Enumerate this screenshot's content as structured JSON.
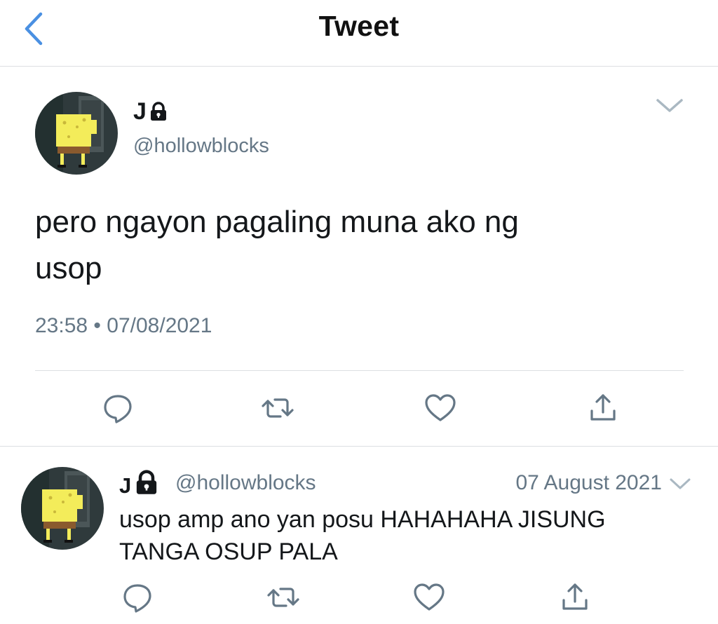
{
  "header": {
    "title": "Tweet"
  },
  "main_tweet": {
    "name": "J",
    "handle": "@hollowblocks",
    "text_line1": "pero ngayon pagaling muna ako ng",
    "text_line2": "usop",
    "time": "23:58",
    "dot": "•",
    "date": "07/08/2021"
  },
  "reply_tweet": {
    "name": "J",
    "handle": "@hollowblocks",
    "date": "07 August 2021",
    "text_line1": "usop amp ano yan posu HAHAHAHA JISUNG",
    "text_line2": "TANGA OSUP PALA"
  },
  "icons": {
    "back": "chevron-left-icon",
    "lock": "lock-icon",
    "more": "chevron-down-icon",
    "reply": "reply-icon",
    "retweet": "retweet-icon",
    "like": "heart-icon",
    "share": "share-icon"
  },
  "colors": {
    "accent": "#4a90e2",
    "secondary_text": "#657786",
    "action_icon": "#657786",
    "divider": "#dcdfe2"
  }
}
